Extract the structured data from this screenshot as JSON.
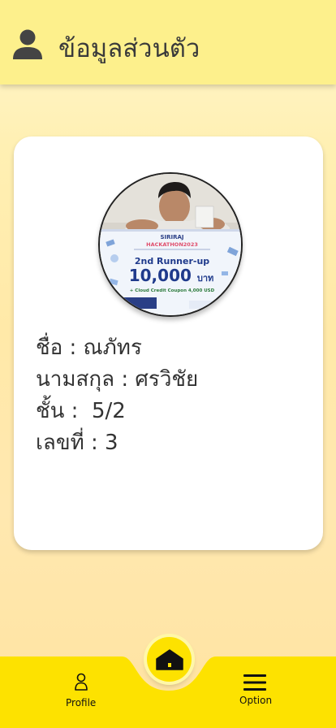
{
  "header": {
    "title": "ข้อมูลส่วนตัว",
    "icon": "person-icon"
  },
  "profile": {
    "photo_caption": {
      "brand": "SIRIRAJ HACKATHON 2023",
      "award": "2nd Runner-up",
      "prize": "10,000 บาท",
      "coupon": "+ Cloud Credit Coupon 4,000 USD"
    },
    "name_row": "ชื่อ : ณภัทร",
    "surname_row": "นามสกุล : ศรวิชัย",
    "class_row": "ชั้น :  5/2",
    "number_row": "เลขที่ : 3"
  },
  "nav": {
    "profile_label": "Profile",
    "option_label": "Option",
    "home_icon": "home-icon",
    "profile_icon": "person-outline-icon",
    "option_icon": "menu-icon"
  },
  "colors": {
    "header_bg": "#fdf08c",
    "nav_bg": "#fde200",
    "text": "#333333"
  }
}
